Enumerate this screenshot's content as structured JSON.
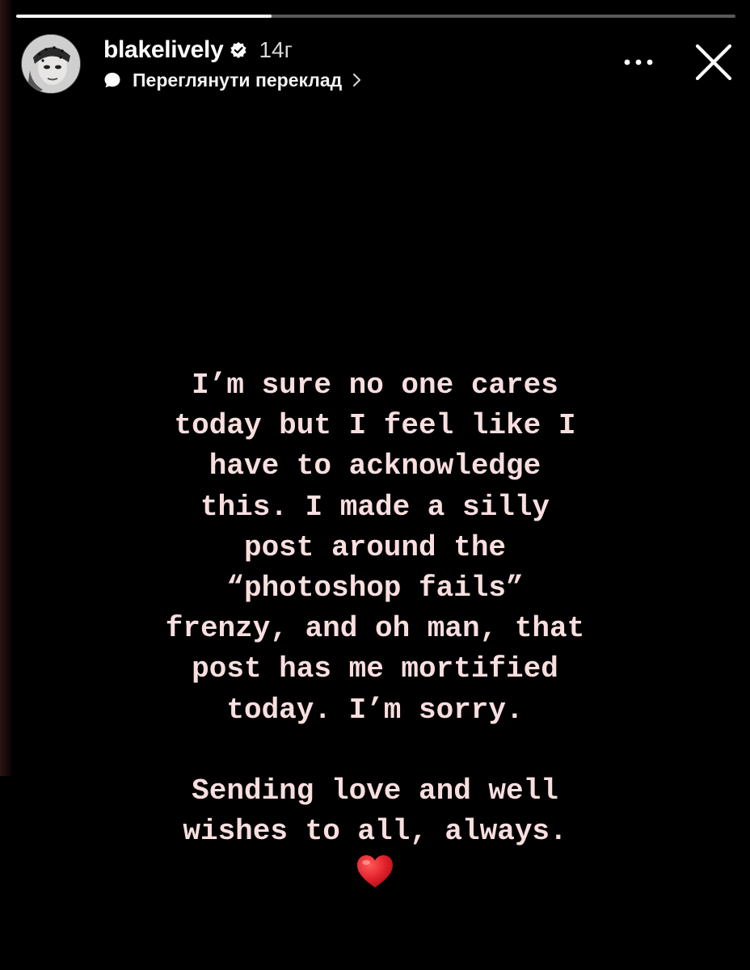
{
  "story": {
    "progress_fraction": 0.355,
    "accent_color": "#f8dede"
  },
  "header": {
    "username": "blakelively",
    "verified_icon": "verified-badge-icon",
    "time_ago": "14г",
    "translate_label": "Переглянути переклад",
    "more_icon": "more-horizontal-icon",
    "close_icon": "close-icon"
  },
  "message": {
    "body": "I’m sure no one cares\ntoday but I feel like I\nhave to acknowledge\nthis. I made a silly\npost around the\n“photoshop fails”\nfrenzy, and oh man, that\npost has me mortified\ntoday. I’m sorry.",
    "sign_off": "Sending love and well\nwishes to all, always.",
    "emoji": "heart-icon"
  }
}
